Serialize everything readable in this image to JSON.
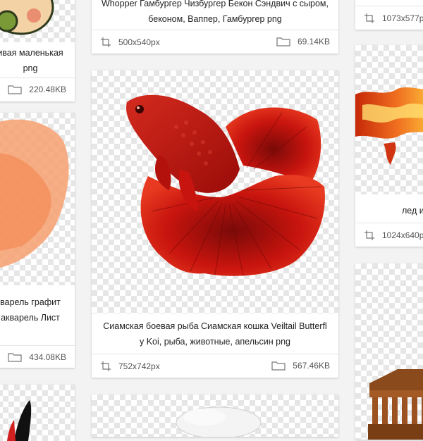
{
  "cards": {
    "left_top": {
      "caption_lines": [
        "ивая маленькая",
        "png"
      ],
      "size": "220.48KB"
    },
    "left_middle": {
      "caption_lines": [
        "варель графит",
        "акварель Лист"
      ],
      "size": "434.08KB"
    },
    "center_top": {
      "caption_lines": [
        "Whopper Гамбургер Чизбургер Бекон Сэндвич с сыром,",
        "беконом, Ваппер, Гамбургер png"
      ],
      "dimensions": "500x540px",
      "size": "69.14KB"
    },
    "center_main": {
      "caption_lines": [
        "Сиамская боевая рыба Сиамская кошка Veiltail Butterfl",
        "y Koi, рыба, животные, апельсин png"
      ],
      "dimensions": "752x742px",
      "size": "567.46KB"
    },
    "right_top": {
      "dimensions": "1073x577p"
    },
    "right_middle": {
      "caption_lines": [
        "лед и"
      ],
      "dimensions": "1024x640p"
    }
  },
  "icons": {
    "dimensions": "crop-icon",
    "size": "folder-icon"
  },
  "colors": {
    "fish_red": "#c8140e",
    "fire_orange": "#f07020",
    "watercolor_orange": "#f7a070"
  }
}
